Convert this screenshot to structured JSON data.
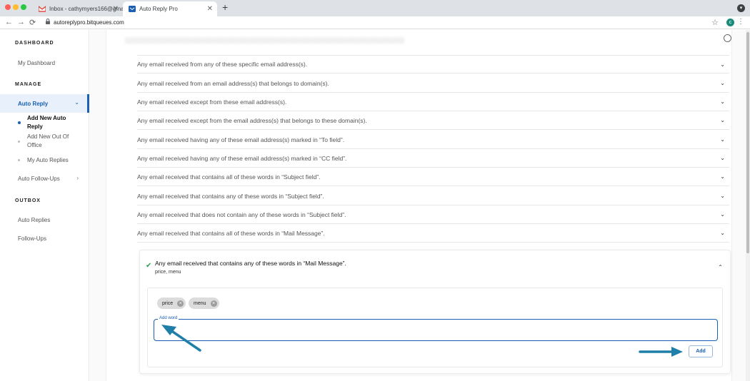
{
  "browser": {
    "tabs": [
      {
        "title": "Inbox - cathymyers166@gmail.c",
        "active": false
      },
      {
        "title": "Auto Reply Pro",
        "active": true
      }
    ],
    "url": "autoreplypro.bitqueues.com",
    "profile_initial": "c"
  },
  "sidebar": {
    "dashboard_heading": "DASHBOARD",
    "my_dashboard": "My Dashboard",
    "manage_heading": "MANAGE",
    "auto_reply": "Auto Reply",
    "sub_items": [
      {
        "label": "Add New Auto Reply",
        "current": true
      },
      {
        "label": "Add New Out Of Office",
        "current": false
      },
      {
        "label": "My Auto Replies",
        "current": false
      }
    ],
    "auto_followups": "Auto Follow-Ups",
    "outbox_heading": "OUTBOX",
    "auto_replies": "Auto Replies",
    "follow_ups": "Follow-Ups"
  },
  "rules": [
    "Any email received from any of these specific email address(s).",
    "Any email received from an email address(s) that belongs to domain(s).",
    "Any email received except from these email address(s).",
    "Any email received except from the email address(s) that belongs to these domain(s).",
    "Any email received having any of these email address(s) marked in “To field”.",
    "Any email received having any of these email address(s) marked in “CC field”.",
    "Any email received that contains all of these words in “Subject field”.",
    "Any email received that contains any of these words in “Subject field”.",
    "Any email received that does not contain any of these words in “Subject field”.",
    "Any email received that contains all of these words in “Mail Message”."
  ],
  "expanded_rule": {
    "title": "Any email received that contains any of these words in “Mail Message”.",
    "summary": "price, menu",
    "chips": [
      "price",
      "menu"
    ],
    "input_label": "Add word",
    "input_value": "",
    "add_button": "Add"
  },
  "colors": {
    "accent": "#1a5fb4",
    "arrow": "#1f7fa8",
    "check": "#2e9e4f"
  }
}
